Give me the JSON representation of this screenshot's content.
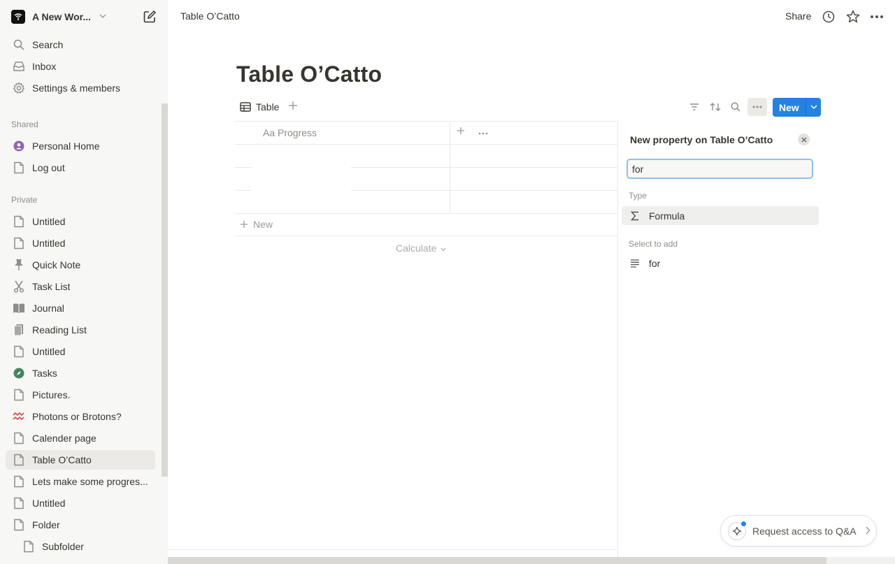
{
  "sidebar": {
    "workspace_name": "A New Wor...",
    "top_items": [
      {
        "label": "Search",
        "icon": "search-icon"
      },
      {
        "label": "Inbox",
        "icon": "inbox-icon"
      },
      {
        "label": "Settings & members",
        "icon": "gear-icon"
      }
    ],
    "shared_label": "Shared",
    "shared_items": [
      {
        "label": "Personal Home",
        "icon": "person-icon"
      },
      {
        "label": "Log out",
        "icon": "page-icon"
      }
    ],
    "private_label": "Private",
    "private_items": [
      {
        "label": "Untitled",
        "icon": "page-icon"
      },
      {
        "label": "Untitled",
        "icon": "page-icon"
      },
      {
        "label": "Quick Note",
        "icon": "pin-icon"
      },
      {
        "label": "Task List",
        "icon": "scissors-icon"
      },
      {
        "label": "Journal",
        "icon": "book-icon"
      },
      {
        "label": "Reading List",
        "icon": "books-icon"
      },
      {
        "label": "Untitled",
        "icon": "page-icon"
      },
      {
        "label": "Tasks",
        "icon": "compass-icon"
      },
      {
        "label": "Pictures.",
        "icon": "page-icon"
      },
      {
        "label": "Photons or Brotons?",
        "icon": "wave-icon"
      },
      {
        "label": "Calender page",
        "icon": "page-icon"
      },
      {
        "label": "Table O’Catto",
        "icon": "page-icon"
      },
      {
        "label": "Lets make some progres...",
        "icon": "page-icon"
      },
      {
        "label": "Untitled",
        "icon": "page-icon"
      },
      {
        "label": "Folder",
        "icon": "page-icon"
      },
      {
        "label": "Subfolder",
        "icon": "page-icon"
      }
    ]
  },
  "topbar": {
    "breadcrumb": "Table O’Catto",
    "share_label": "Share"
  },
  "page": {
    "title": "Table O’Catto",
    "view_tab_label": "Table",
    "new_button_label": "New",
    "column_header": "Aa Progress",
    "new_row_label": "New",
    "calculate_label": "Calculate"
  },
  "panel": {
    "title": "New property on Table O’Catto",
    "input_value": "for",
    "type_label": "Type",
    "type_option": "Formula",
    "select_label": "Select to add",
    "select_option": "for"
  },
  "qa": {
    "label": "Request access to Q&A"
  },
  "colors": {
    "accent": "#2383e2",
    "sidebar_bg": "#f7f7f5"
  }
}
